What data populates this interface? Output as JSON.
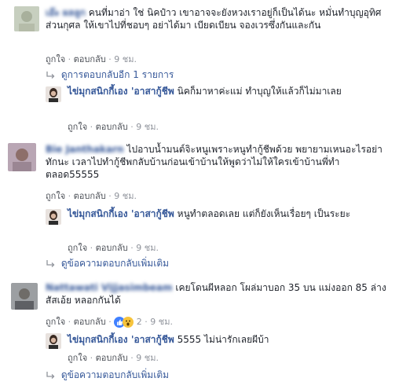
{
  "comments": [
    {
      "author": "เอ๊ะ ผลลูก",
      "text": "คนที่มาอ่า ใช่ นิคป๋าว เขาอาจจะยังหวงเราอยู่ก็เป็นได้นะ หมั่นทำบุญอุทิศส่วนกุศล ให้เขาไปที่ชอบๆ อย่าได้มา เบียดเบียน จองเวรซึ่งกันและกัน",
      "like": "ถูกใจ",
      "reply": "ตอบกลับ",
      "time": "9 ชม.",
      "view_replies": "ดูการตอบกลับอีก 1 รายการ",
      "replies": [
        {
          "author": "ไข่มุกสนิกกี้เอง 'อาสากู้ชีพ",
          "text": "นิคก็มาหาค่ะแม่ ทำบุญให้แล้วก็ไม่มาเลย",
          "like": "ถูกใจ",
          "reply": "ตอบกลับ",
          "time": "9 ชม."
        }
      ]
    },
    {
      "author": "Bie Janthakarn",
      "text": "ไปอาบน้ำมนต์จิะหนูเพราะหนูทำกู้ชีพด้วย พยายามเหนอะไรอย่าทักนะ เวลาไปทำกู้ชีพกลับบ้านก่อนเข้าบ้านให้พูดว่าไม่ให้ใครเข้าบ้านพี่ทำตลอด55555",
      "like": "ถูกใจ",
      "reply": "ตอบกลับ",
      "time": "9 ชม.",
      "replies": [
        {
          "author": "ไข่มุกสนิกกี้เอง 'อาสากู้ชีพ",
          "text": "หนูทำตลอดเลย แต่ก็ยังเห็นเรื่อยๆ เป็นระยะ",
          "like": "ถูกใจ",
          "reply": "ตอบกลับ",
          "time": "9 ชม."
        }
      ],
      "more_replies": "ดูข้อความตอบกลับเพิ่มเติม"
    },
    {
      "author": "Nattawati Vijjasimbeam",
      "text": "เคยโดนผีหลอก โผล่มาบอก 35 บน แม่งออก 85 ล่าง สัสเอ้ย หลอกกันได้",
      "like": "ถูกใจ",
      "reply": "ตอบกลับ",
      "reaction_count": "2",
      "time": "9 ชม.",
      "replies": [
        {
          "author": "ไข่มุกสนิกกี้เอง 'อาสากู้ชีพ",
          "text": "5555 ไม่น่ารักเลยผีบ้า",
          "like": "ถูกใจ",
          "reply": "ตอบกลับ",
          "time": "9 ชม."
        }
      ],
      "more_replies": "ดูข้อความตอบกลับเพิ่มเติม"
    }
  ],
  "colors": {
    "link": "#365899",
    "meta": "#90949c",
    "text": "#1d2129"
  }
}
